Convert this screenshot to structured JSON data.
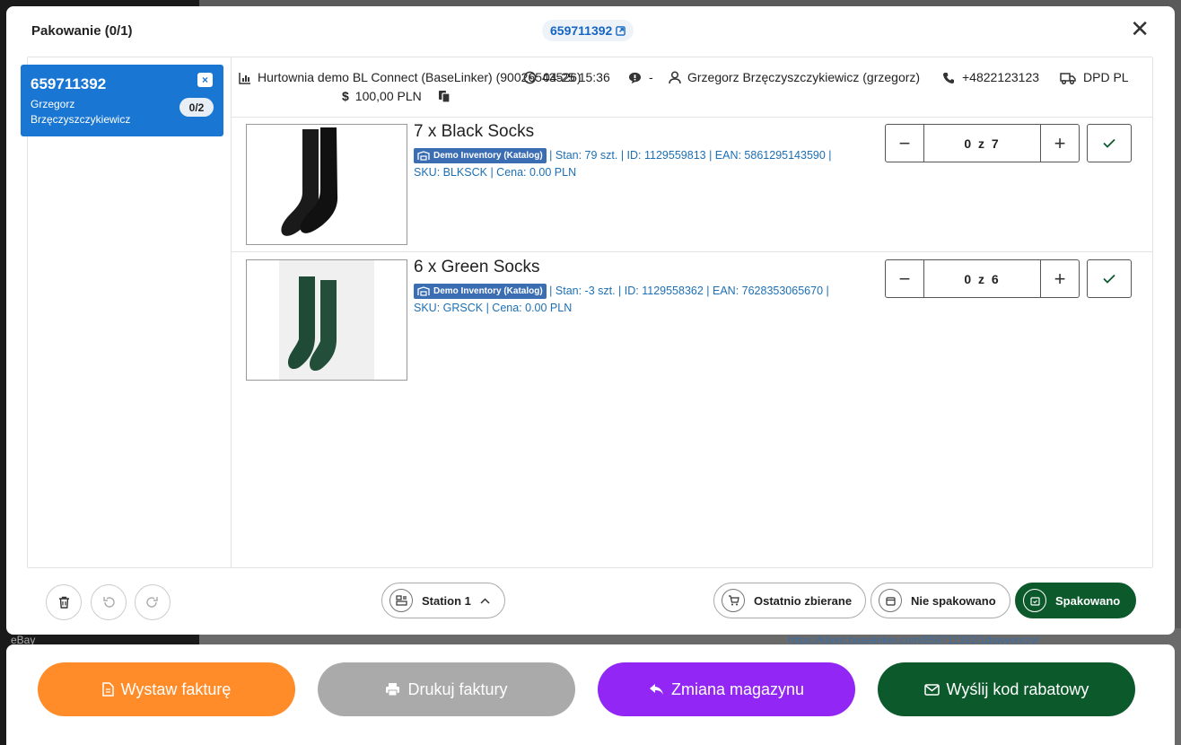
{
  "modal": {
    "title": "Pakowanie  (0/1)",
    "order_badge": "659711392",
    "close_label": "✕"
  },
  "order_card": {
    "number": "659711392",
    "customer": "Grzegorz Brzęczyszczykiewicz",
    "close_label": "×",
    "progress": "0/2"
  },
  "info": {
    "source": "Hurtownia demo BL Connect (BaseLinker) (90026543526)",
    "datetime": "04-25 15:36",
    "comment": "-",
    "customer": "Grzegorz Brzęczyszczykiewicz (grzegorz)",
    "phone": "+4822123123",
    "shipping": "DPD PL",
    "amount": "100,00 PLN"
  },
  "products": [
    {
      "title": "7 x Black Socks",
      "inventory_tag": "Demo Inventory (Katalog)",
      "meta_line1": " | Stan: 79 szt. | ID: 1129559813 | EAN: 5861295143590 |",
      "meta_line2": "SKU: BLKSCK | Cena: 0.00 PLN",
      "quantity": "0 z 7"
    },
    {
      "title": "6 x Green Socks",
      "inventory_tag": "Demo Inventory (Katalog)",
      "meta_line1": " | Stan: -3 szt. | ID: 1129558362 | EAN: 7628353065670 |",
      "meta_line2": "SKU: GRSCK | Cena: 0.00 PLN",
      "quantity": "0 z 6"
    }
  ],
  "footer": {
    "station": "Station 1",
    "recent": "Ostatnio zbierane",
    "not_packed": "Nie spakowano",
    "packed": "Spakowano"
  },
  "actions": {
    "invoice": "Wystaw fakturę",
    "print": "Drukuj faktury",
    "warehouse": "Zmiana magazynu",
    "discount": "Wyślij kod rabatowy"
  },
  "background": {
    "ebay": "eBay",
    "link": "https://klient.baselinker.com/659711392/1dswyenrzy/"
  },
  "colors": {
    "primary_blue": "#1976d2",
    "orange": "#ff8c28",
    "gray": "#aaaaaa",
    "purple": "#9227f5",
    "dark_green": "#0c5a2c"
  }
}
